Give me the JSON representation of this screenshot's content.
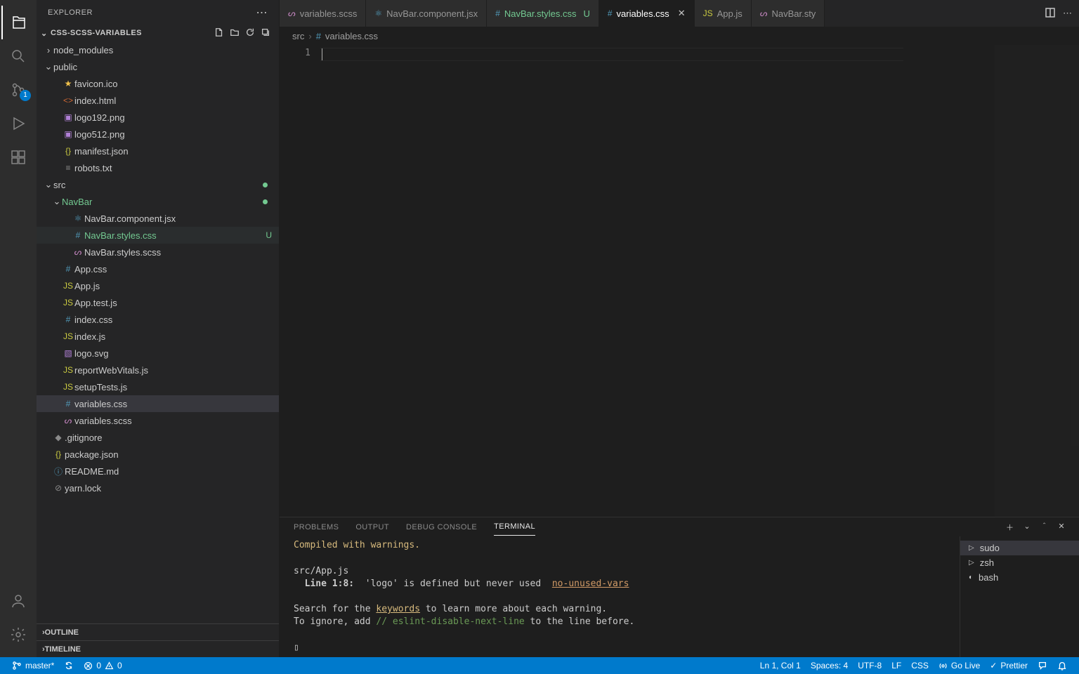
{
  "explorer": {
    "title": "EXPLORER",
    "project": "CSS-SCSS-VARIABLES",
    "outline": "OUTLINE",
    "timeline": "TIMELINE"
  },
  "scm_badge": "1",
  "tree": [
    {
      "depth": 0,
      "type": "folder",
      "open": false,
      "name": "node_modules",
      "icon": "folder"
    },
    {
      "depth": 0,
      "type": "folder",
      "open": true,
      "name": "public",
      "icon": "folder"
    },
    {
      "depth": 1,
      "type": "file",
      "name": "favicon.ico",
      "icon": "star",
      "iconClass": "color-star"
    },
    {
      "depth": 1,
      "type": "file",
      "name": "index.html",
      "icon": "<>",
      "iconClass": "color-orange"
    },
    {
      "depth": 1,
      "type": "file",
      "name": "logo192.png",
      "icon": "▣",
      "iconClass": "color-purple"
    },
    {
      "depth": 1,
      "type": "file",
      "name": "logo512.png",
      "icon": "▣",
      "iconClass": "color-purple"
    },
    {
      "depth": 1,
      "type": "file",
      "name": "manifest.json",
      "icon": "{}",
      "iconClass": "color-jsyellow"
    },
    {
      "depth": 1,
      "type": "file",
      "name": "robots.txt",
      "icon": "≡",
      "iconClass": "color-gray"
    },
    {
      "depth": 0,
      "type": "folder",
      "open": true,
      "name": "src",
      "icon": "folder",
      "dot": true
    },
    {
      "depth": 1,
      "type": "folder",
      "open": true,
      "name": "NavBar",
      "icon": "folder",
      "labelClass": "color-green",
      "dot": true
    },
    {
      "depth": 2,
      "type": "file",
      "name": "NavBar.component.jsx",
      "icon": "⚛",
      "iconClass": "color-blue"
    },
    {
      "depth": 2,
      "type": "file",
      "name": "NavBar.styles.css",
      "icon": "#",
      "iconClass": "color-blue",
      "labelClass": "color-green",
      "status": "U",
      "hovered": true
    },
    {
      "depth": 2,
      "type": "file",
      "name": "NavBar.styles.scss",
      "icon": "ᔕ",
      "iconClass": "color-pink"
    },
    {
      "depth": 1,
      "type": "file",
      "name": "App.css",
      "icon": "#",
      "iconClass": "color-blue"
    },
    {
      "depth": 1,
      "type": "file",
      "name": "App.js",
      "icon": "JS",
      "iconClass": "color-jsyellow"
    },
    {
      "depth": 1,
      "type": "file",
      "name": "App.test.js",
      "icon": "JS",
      "iconClass": "color-jsyellow"
    },
    {
      "depth": 1,
      "type": "file",
      "name": "index.css",
      "icon": "#",
      "iconClass": "color-blue"
    },
    {
      "depth": 1,
      "type": "file",
      "name": "index.js",
      "icon": "JS",
      "iconClass": "color-jsyellow"
    },
    {
      "depth": 1,
      "type": "file",
      "name": "logo.svg",
      "icon": "▧",
      "iconClass": "color-purple"
    },
    {
      "depth": 1,
      "type": "file",
      "name": "reportWebVitals.js",
      "icon": "JS",
      "iconClass": "color-jsyellow"
    },
    {
      "depth": 1,
      "type": "file",
      "name": "setupTests.js",
      "icon": "JS",
      "iconClass": "color-jsyellow"
    },
    {
      "depth": 1,
      "type": "file",
      "name": "variables.css",
      "icon": "#",
      "iconClass": "color-blue",
      "selected": true
    },
    {
      "depth": 1,
      "type": "file",
      "name": "variables.scss",
      "icon": "ᔕ",
      "iconClass": "color-pink"
    },
    {
      "depth": 0,
      "type": "file",
      "name": ".gitignore",
      "icon": "◆",
      "iconClass": "color-gray"
    },
    {
      "depth": 0,
      "type": "file",
      "name": "package.json",
      "icon": "{}",
      "iconClass": "color-jsyellow"
    },
    {
      "depth": 0,
      "type": "file",
      "name": "README.md",
      "icon": "ⓘ",
      "iconClass": "color-blue"
    },
    {
      "depth": 0,
      "type": "file",
      "name": "yarn.lock",
      "icon": "⊘",
      "iconClass": "color-gray"
    }
  ],
  "tabs": [
    {
      "label": "variables.scss",
      "icon": "ᔕ",
      "iconClass": "color-pink",
      "truncated": true
    },
    {
      "label": "NavBar.component.jsx",
      "icon": "⚛",
      "iconClass": "color-blue"
    },
    {
      "label": "NavBar.styles.css",
      "icon": "#",
      "iconClass": "color-blue",
      "status": "U",
      "labelClass": "color-green"
    },
    {
      "label": "variables.css",
      "icon": "#",
      "iconClass": "color-blue",
      "active": true,
      "close": true
    },
    {
      "label": "App.js",
      "icon": "JS",
      "iconClass": "color-jsyellow"
    },
    {
      "label": "NavBar.sty",
      "icon": "ᔕ",
      "iconClass": "color-pink",
      "truncated": true
    }
  ],
  "breadcrumbs": {
    "root": "src",
    "sep": "›",
    "icon": "#",
    "file": "variables.css"
  },
  "editor": {
    "line_number": "1"
  },
  "panel": {
    "tabs": {
      "problems": "PROBLEMS",
      "output": "OUTPUT",
      "debug": "DEBUG CONSOLE",
      "terminal": "TERMINAL"
    },
    "terminals": [
      {
        "name": "sudo",
        "icon": "❯"
      },
      {
        "name": "zsh",
        "icon": "❯"
      },
      {
        "name": "bash",
        "icon": "●"
      }
    ],
    "out_l1": "Compiled with warnings.",
    "out_l2": "src/App.js",
    "out_l3a": "  Line 1:8:",
    "out_l3b": "  'logo' is defined but never used  ",
    "out_l3c": "no-unused-vars",
    "out_l4a": "Search for the ",
    "out_l4b": "keywords",
    "out_l4c": " to learn more about each warning.",
    "out_l5a": "To ignore, add ",
    "out_l5b": "// eslint-disable-next-line",
    "out_l5c": " to the line before.",
    "out_prompt": "▯"
  },
  "status": {
    "branch": "master*",
    "errors": "0",
    "warnings": "0",
    "lncol": "Ln 1, Col 1",
    "spaces": "Spaces: 4",
    "encoding": "UTF-8",
    "eol": "LF",
    "lang": "CSS",
    "golive": "Go Live",
    "prettier": "Prettier"
  }
}
